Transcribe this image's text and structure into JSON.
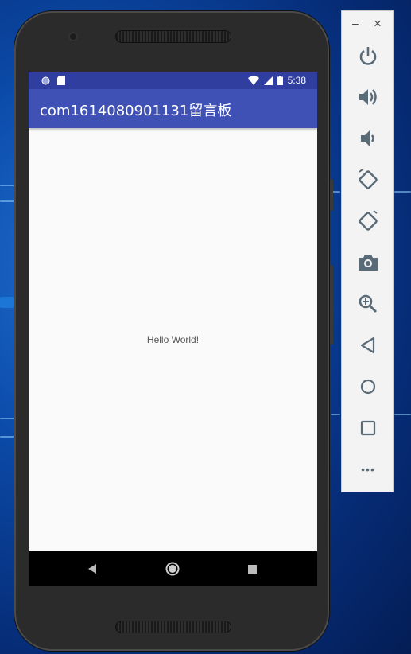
{
  "status_bar": {
    "time": "5:38"
  },
  "app": {
    "title": "com1614080901131留言板"
  },
  "content": {
    "text": "Hello World!"
  },
  "colors": {
    "primary": "#3f51b5",
    "primary_dark": "#303f9f",
    "screen_bg": "#fafafa"
  },
  "toolbar": {
    "minimize_label": "–",
    "close_label": "×",
    "buttons": [
      {
        "name": "power-icon"
      },
      {
        "name": "volume-up-icon"
      },
      {
        "name": "volume-down-icon"
      },
      {
        "name": "rotate-left-icon"
      },
      {
        "name": "rotate-right-icon"
      },
      {
        "name": "camera-icon"
      },
      {
        "name": "zoom-icon"
      },
      {
        "name": "back-icon"
      },
      {
        "name": "home-icon"
      },
      {
        "name": "overview-icon"
      },
      {
        "name": "more-icon"
      }
    ],
    "more_label": "•••"
  },
  "nav": {
    "back": "back-icon",
    "home": "home-icon",
    "recents": "recents-icon"
  }
}
